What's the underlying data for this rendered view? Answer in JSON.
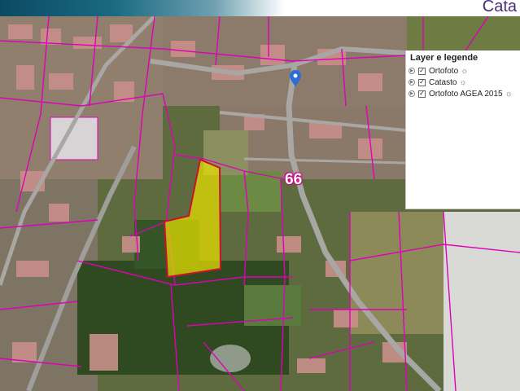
{
  "header": {
    "brand_text": "Cata"
  },
  "map": {
    "route_label": "66",
    "pin_icon": "map-pin-icon",
    "colors": {
      "parcel_lines": "#e000b8",
      "selected_parcel_fill": "#e8e000",
      "selected_parcel_outline": "#cc1030",
      "pin": "#2b6fd6",
      "road": "#a9a7a4",
      "vegetation": "#2f5a22",
      "buildings": "#c98f8a"
    }
  },
  "layer_panel": {
    "title": "Layer e legende",
    "layers": [
      {
        "label": "Ortofoto",
        "checked": true,
        "icon": "sun-icon"
      },
      {
        "label": "Catasto",
        "checked": true,
        "icon": "sun-icon"
      },
      {
        "label": "Ortofoto AGEA 2015",
        "checked": true,
        "icon": "sun-icon"
      }
    ]
  }
}
